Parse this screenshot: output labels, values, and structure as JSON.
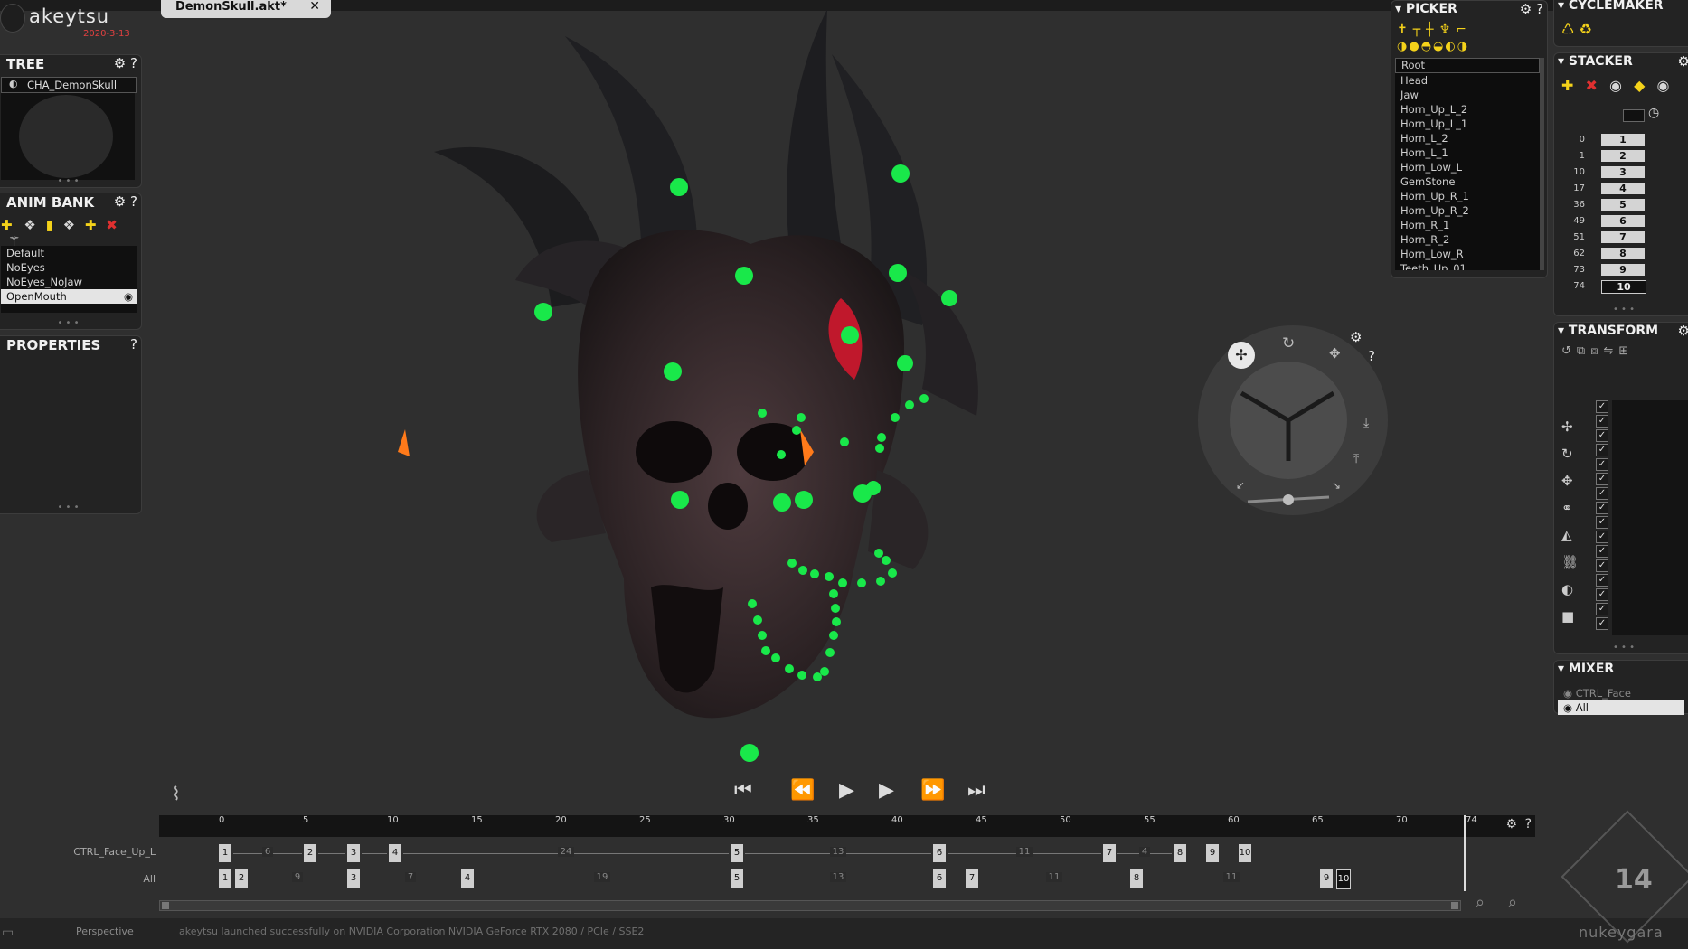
{
  "app": {
    "logo": "akeytsu",
    "date": "2020-3-13"
  },
  "tab": {
    "title": "DemonSkull.akt*",
    "close": "✕"
  },
  "tree": {
    "title": "TREE",
    "item": "CHA_DemonSkull"
  },
  "animbank": {
    "title": "ANIM BANK",
    "items": [
      "Default",
      "NoEyes",
      "NoEyes_NoJaw",
      "OpenMouth"
    ]
  },
  "properties": {
    "title": "PROPERTIES"
  },
  "picker": {
    "title": "PICKER",
    "bones": [
      "Root",
      "Head",
      "Jaw",
      "Horn_Up_L_2",
      "Horn_Up_L_1",
      "Horn_L_2",
      "Horn_L_1",
      "Horn_Low_L",
      "GemStone",
      "Horn_Up_R_1",
      "Horn_Up_R_2",
      "Horn_R_1",
      "Horn_R_2",
      "Horn_Low_R",
      "Teeth_Up_01"
    ]
  },
  "cyclemaker": {
    "title": "CYCLEMAKER"
  },
  "stacker": {
    "title": "STACKER",
    "rows": [
      {
        "frame": "0",
        "key": "1"
      },
      {
        "frame": "1",
        "key": "2"
      },
      {
        "frame": "10",
        "key": "3"
      },
      {
        "frame": "17",
        "key": "4"
      },
      {
        "frame": "36",
        "key": "5"
      },
      {
        "frame": "49",
        "key": "6"
      },
      {
        "frame": "51",
        "key": "7"
      },
      {
        "frame": "62",
        "key": "8"
      },
      {
        "frame": "73",
        "key": "9"
      },
      {
        "frame": "74",
        "key": "10"
      }
    ]
  },
  "transform": {
    "title": "TRANSFORM"
  },
  "mixer": {
    "title": "MIXER",
    "items": [
      "CTRL_Face",
      "All"
    ]
  },
  "timeline": {
    "ruler": [
      "0",
      "5",
      "10",
      "15",
      "20",
      "25",
      "30",
      "35",
      "40",
      "45",
      "50",
      "55",
      "60",
      "65",
      "70",
      "74"
    ],
    "track1": {
      "label": "CTRL_Face_Up_L"
    },
    "track2": {
      "label": "All"
    }
  },
  "viewport": {
    "camera": "Perspective"
  },
  "status": {
    "message": "akeytsu launched successfully on NVIDIA Corporation NVIDIA GeForce RTX 2080 / PCIe / SSE2"
  },
  "brand": {
    "name": "nukeygara",
    "version": "14"
  },
  "colors": {
    "controller": "#19e84a",
    "gem": "#c0182c",
    "eye": "#ff7a1a",
    "key_yellow": "#f4d21a"
  }
}
